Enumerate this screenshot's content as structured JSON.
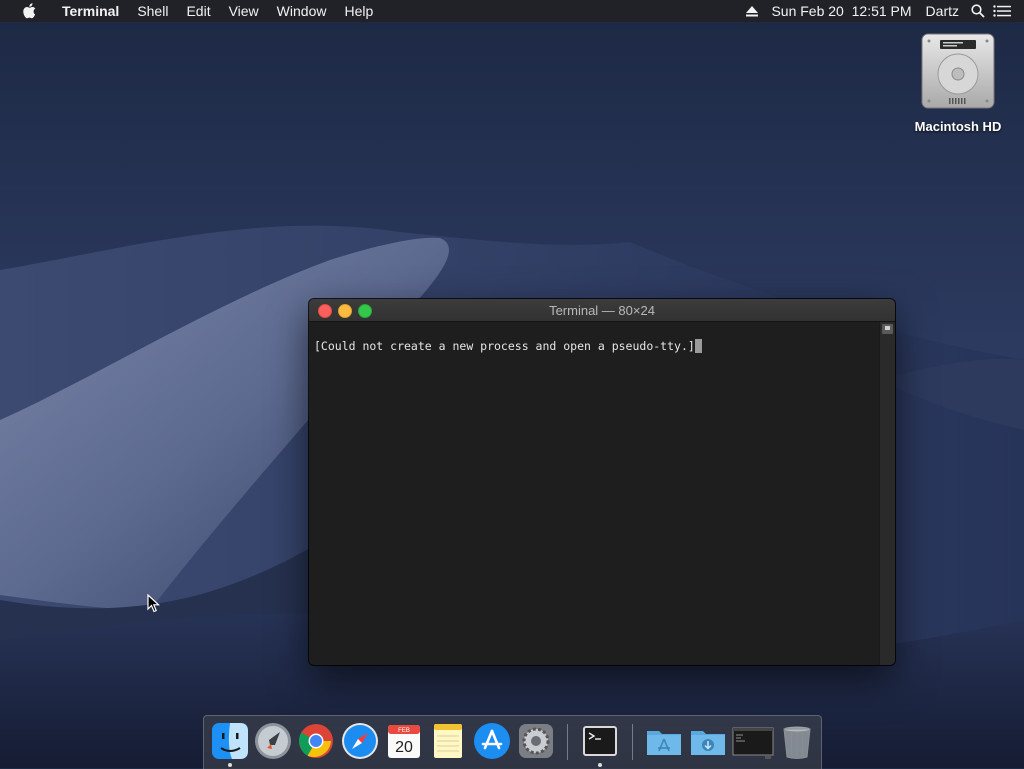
{
  "menubar": {
    "apple_icon": "apple-logo-icon",
    "app_name": "Terminal",
    "menus": [
      "Shell",
      "Edit",
      "View",
      "Window",
      "Help"
    ],
    "status": {
      "eject_icon": "eject-icon",
      "datetime": "Sun Feb 20  12:51 PM",
      "user": "Dartz",
      "search_icon": "spotlight-search-icon",
      "notification_icon": "notification-center-icon"
    }
  },
  "desktop": {
    "drive_label": "Macintosh HD",
    "drive_icon": "hard-drive-icon"
  },
  "terminal": {
    "title": "Terminal — 80×24",
    "output": "[Could not create a new process and open a pseudo-tty.]"
  },
  "dock": {
    "calendar_month": "FEB",
    "calendar_day": "20",
    "apps": [
      {
        "name": "Finder",
        "icon": "finder-icon",
        "running": true
      },
      {
        "name": "Launchpad",
        "icon": "launchpad-rocket-icon",
        "running": false
      },
      {
        "name": "Google Chrome",
        "icon": "chrome-icon",
        "running": false
      },
      {
        "name": "Safari",
        "icon": "safari-compass-icon",
        "running": false
      },
      {
        "name": "Calendar",
        "icon": "calendar-icon",
        "running": false
      },
      {
        "name": "Notes",
        "icon": "notes-icon",
        "running": false
      },
      {
        "name": "App Store",
        "icon": "app-store-icon",
        "running": false
      },
      {
        "name": "System Preferences",
        "icon": "system-preferences-gear-icon",
        "running": false
      },
      {
        "name": "Terminal",
        "icon": "terminal-icon",
        "running": true
      }
    ],
    "folders": [
      {
        "name": "Applications",
        "icon": "applications-folder-icon"
      },
      {
        "name": "Downloads",
        "icon": "downloads-folder-icon"
      }
    ],
    "minimized": {
      "name": "Terminal window",
      "icon": "minimized-terminal-window-icon"
    },
    "trash_icon": "trash-icon"
  },
  "colors": {
    "menubar_bg": "#222226",
    "terminal_bg": "#1e1e1e",
    "close": "#fc605c",
    "minimize": "#fdbc40",
    "maximize": "#34c84a"
  }
}
